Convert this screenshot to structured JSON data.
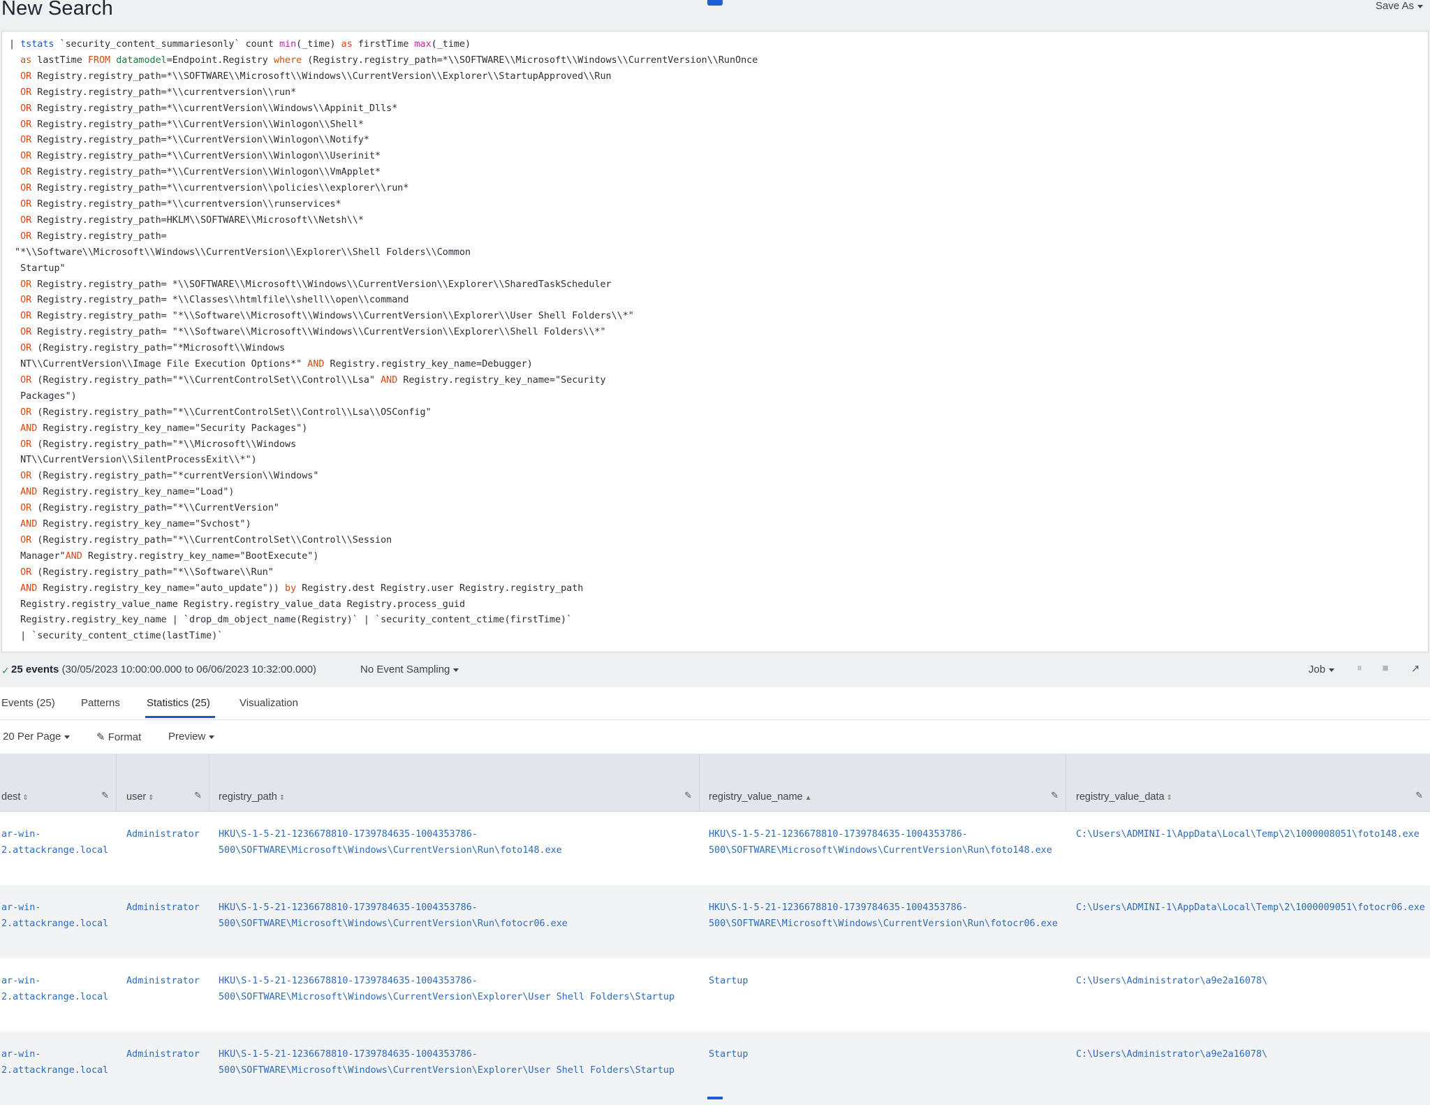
{
  "header": {
    "title": "New Search",
    "save_as_label": "Save As"
  },
  "query_lines": [
    [
      {
        "t": "| ",
        "c": "pipe"
      },
      {
        "t": "tstats",
        "c": "cmd"
      },
      {
        "t": " `security_content_summariesonly` count ",
        "c": "txt"
      },
      {
        "t": "min",
        "c": "fn"
      },
      {
        "t": "(_time) ",
        "c": "txt"
      },
      {
        "t": "as",
        "c": "kw"
      },
      {
        "t": " firstTime ",
        "c": "txt"
      },
      {
        "t": "max",
        "c": "fn"
      },
      {
        "t": "(_time)",
        "c": "txt"
      }
    ],
    [
      {
        "t": "  ",
        "c": "txt"
      },
      {
        "t": "as",
        "c": "kw"
      },
      {
        "t": " lastTime ",
        "c": "txt"
      },
      {
        "t": "FROM",
        "c": "kw"
      },
      {
        "t": " ",
        "c": "txt"
      },
      {
        "t": "datamodel",
        "c": "arg"
      },
      {
        "t": "=Endpoint.Registry ",
        "c": "txt"
      },
      {
        "t": "where",
        "c": "kw"
      },
      {
        "t": " (Registry.registry_path=*\\\\SOFTWARE\\\\Microsoft\\\\Windows\\\\CurrentVersion\\\\RunOnce",
        "c": "txt"
      }
    ],
    [
      {
        "t": "  ",
        "c": "txt"
      },
      {
        "t": "OR",
        "c": "kw"
      },
      {
        "t": " Registry.registry_path=*\\\\SOFTWARE\\\\Microsoft\\\\Windows\\\\CurrentVersion\\\\Explorer\\\\StartupApproved\\\\Run",
        "c": "txt"
      }
    ],
    [
      {
        "t": "  ",
        "c": "txt"
      },
      {
        "t": "OR",
        "c": "kw"
      },
      {
        "t": " Registry.registry_path=*\\\\currentversion\\\\run*",
        "c": "txt"
      }
    ],
    [
      {
        "t": "  ",
        "c": "txt"
      },
      {
        "t": "OR",
        "c": "kw"
      },
      {
        "t": " Registry.registry_path=*\\\\currentVersion\\\\Windows\\\\Appinit_Dlls*",
        "c": "txt"
      }
    ],
    [
      {
        "t": "  ",
        "c": "txt"
      },
      {
        "t": "OR",
        "c": "kw"
      },
      {
        "t": " Registry.registry_path=*\\\\CurrentVersion\\\\Winlogon\\\\Shell*",
        "c": "txt"
      }
    ],
    [
      {
        "t": "  ",
        "c": "txt"
      },
      {
        "t": "OR",
        "c": "kw"
      },
      {
        "t": " Registry.registry_path=*\\\\CurrentVersion\\\\Winlogon\\\\Notify*",
        "c": "txt"
      }
    ],
    [
      {
        "t": "  ",
        "c": "txt"
      },
      {
        "t": "OR",
        "c": "kw"
      },
      {
        "t": " Registry.registry_path=*\\\\CurrentVersion\\\\Winlogon\\\\Userinit*",
        "c": "txt"
      }
    ],
    [
      {
        "t": "  ",
        "c": "txt"
      },
      {
        "t": "OR",
        "c": "kw"
      },
      {
        "t": " Registry.registry_path=*\\\\CurrentVersion\\\\Winlogon\\\\VmApplet*",
        "c": "txt"
      }
    ],
    [
      {
        "t": "  ",
        "c": "txt"
      },
      {
        "t": "OR",
        "c": "kw"
      },
      {
        "t": " Registry.registry_path=*\\\\currentversion\\\\policies\\\\explorer\\\\run*",
        "c": "txt"
      }
    ],
    [
      {
        "t": "  ",
        "c": "txt"
      },
      {
        "t": "OR",
        "c": "kw"
      },
      {
        "t": " Registry.registry_path=*\\\\currentversion\\\\runservices*",
        "c": "txt"
      }
    ],
    [
      {
        "t": "  ",
        "c": "txt"
      },
      {
        "t": "OR",
        "c": "kw"
      },
      {
        "t": " Registry.registry_path=HKLM\\\\SOFTWARE\\\\Microsoft\\\\Netsh\\\\*",
        "c": "txt"
      }
    ],
    [
      {
        "t": "  ",
        "c": "txt"
      },
      {
        "t": "OR",
        "c": "kw"
      },
      {
        "t": " Registry.registry_path=",
        "c": "txt"
      }
    ],
    [
      {
        "t": " \"*\\\\Software\\\\Microsoft\\\\Windows\\\\CurrentVersion\\\\Explorer\\\\Shell Folders\\\\Common",
        "c": "txt"
      }
    ],
    [
      {
        "t": "  Startup\"",
        "c": "txt"
      }
    ],
    [
      {
        "t": "  ",
        "c": "txt"
      },
      {
        "t": "OR",
        "c": "kw"
      },
      {
        "t": " Registry.registry_path= *\\\\SOFTWARE\\\\Microsoft\\\\Windows\\\\CurrentVersion\\\\Explorer\\\\SharedTaskScheduler",
        "c": "txt"
      }
    ],
    [
      {
        "t": "  ",
        "c": "txt"
      },
      {
        "t": "OR",
        "c": "kw"
      },
      {
        "t": " Registry.registry_path= *\\\\Classes\\\\htmlfile\\\\shell\\\\open\\\\command",
        "c": "txt"
      }
    ],
    [
      {
        "t": "  ",
        "c": "txt"
      },
      {
        "t": "OR",
        "c": "kw"
      },
      {
        "t": " Registry.registry_path= \"*\\\\Software\\\\Microsoft\\\\Windows\\\\CurrentVersion\\\\Explorer\\\\User Shell Folders\\\\*\"",
        "c": "txt"
      }
    ],
    [
      {
        "t": "  ",
        "c": "txt"
      },
      {
        "t": "OR",
        "c": "kw"
      },
      {
        "t": " Registry.registry_path= \"*\\\\Software\\\\Microsoft\\\\Windows\\\\CurrentVersion\\\\Explorer\\\\Shell Folders\\\\*\"",
        "c": "txt"
      }
    ],
    [
      {
        "t": "  ",
        "c": "txt"
      },
      {
        "t": "OR",
        "c": "kw"
      },
      {
        "t": " (Registry.registry_path=\"*Microsoft\\\\Windows",
        "c": "txt"
      }
    ],
    [
      {
        "t": "  NT\\\\CurrentVersion\\\\Image File Execution Options*\" ",
        "c": "txt"
      },
      {
        "t": "AND",
        "c": "kw"
      },
      {
        "t": " Registry.registry_key_name=Debugger)",
        "c": "txt"
      }
    ],
    [
      {
        "t": "  ",
        "c": "txt"
      },
      {
        "t": "OR",
        "c": "kw"
      },
      {
        "t": " (Registry.registry_path=\"*\\\\CurrentControlSet\\\\Control\\\\Lsa\" ",
        "c": "txt"
      },
      {
        "t": "AND",
        "c": "kw"
      },
      {
        "t": " Registry.registry_key_name=\"Security",
        "c": "txt"
      }
    ],
    [
      {
        "t": "  Packages\")",
        "c": "txt"
      }
    ],
    [
      {
        "t": "  ",
        "c": "txt"
      },
      {
        "t": "OR",
        "c": "kw"
      },
      {
        "t": " (Registry.registry_path=\"*\\\\CurrentControlSet\\\\Control\\\\Lsa\\\\OSConfig\"",
        "c": "txt"
      }
    ],
    [
      {
        "t": "  ",
        "c": "txt"
      },
      {
        "t": "AND",
        "c": "kw"
      },
      {
        "t": " Registry.registry_key_name=\"Security Packages\")",
        "c": "txt"
      }
    ],
    [
      {
        "t": "  ",
        "c": "txt"
      },
      {
        "t": "OR",
        "c": "kw"
      },
      {
        "t": " (Registry.registry_path=\"*\\\\Microsoft\\\\Windows",
        "c": "txt"
      }
    ],
    [
      {
        "t": "  NT\\\\CurrentVersion\\\\SilentProcessExit\\\\*\")",
        "c": "txt"
      }
    ],
    [
      {
        "t": "  ",
        "c": "txt"
      },
      {
        "t": "OR",
        "c": "kw"
      },
      {
        "t": " (Registry.registry_path=\"*currentVersion\\\\Windows\"",
        "c": "txt"
      }
    ],
    [
      {
        "t": "  ",
        "c": "txt"
      },
      {
        "t": "AND",
        "c": "kw"
      },
      {
        "t": " Registry.registry_key_name=\"Load\")",
        "c": "txt"
      }
    ],
    [
      {
        "t": "  ",
        "c": "txt"
      },
      {
        "t": "OR",
        "c": "kw"
      },
      {
        "t": " (Registry.registry_path=\"*\\\\CurrentVersion\"",
        "c": "txt"
      }
    ],
    [
      {
        "t": "  ",
        "c": "txt"
      },
      {
        "t": "AND",
        "c": "kw"
      },
      {
        "t": " Registry.registry_key_name=\"Svchost\")",
        "c": "txt"
      }
    ],
    [
      {
        "t": "  ",
        "c": "txt"
      },
      {
        "t": "OR",
        "c": "kw"
      },
      {
        "t": " (Registry.registry_path=\"*\\\\CurrentControlSet\\\\Control\\\\Session",
        "c": "txt"
      }
    ],
    [
      {
        "t": "  Manager\"",
        "c": "txt"
      },
      {
        "t": "AND",
        "c": "kw"
      },
      {
        "t": " Registry.registry_key_name=\"BootExecute\")",
        "c": "txt"
      }
    ],
    [
      {
        "t": "  ",
        "c": "txt"
      },
      {
        "t": "OR",
        "c": "kw"
      },
      {
        "t": " (Registry.registry_path=\"*\\\\Software\\\\Run\"",
        "c": "txt"
      }
    ],
    [
      {
        "t": "  ",
        "c": "txt"
      },
      {
        "t": "AND",
        "c": "kw"
      },
      {
        "t": " Registry.registry_key_name=\"auto_update\")) ",
        "c": "txt"
      },
      {
        "t": "by",
        "c": "kw"
      },
      {
        "t": " Registry.dest Registry.user Registry.registry_path",
        "c": "txt"
      }
    ],
    [
      {
        "t": "  Registry.registry_value_name Registry.registry_value_data Registry.process_guid",
        "c": "txt"
      }
    ],
    [
      {
        "t": "  Registry.registry_key_name | `drop_dm_object_name(Registry)` | `security_content_ctime(firstTime)`",
        "c": "txt"
      }
    ],
    [
      {
        "t": "  | `security_content_ctime(lastTime)`",
        "c": "txt"
      }
    ]
  ],
  "status": {
    "check": "✓",
    "event_count": "25 events",
    "time_range": "(30/05/2023 10:00:00.000 to 06/06/2023 10:32:00.000)",
    "sampling": "No Event Sampling",
    "job": "Job",
    "pause_icon": "⏸",
    "stop_icon": "■",
    "share_icon": "↗"
  },
  "tabs": [
    "Events (25)",
    "Patterns",
    "Statistics (25)",
    "Visualization"
  ],
  "toolbar": {
    "per_page": "20 Per Page",
    "format": "Format",
    "preview": "Preview"
  },
  "table": {
    "columns": [
      {
        "name": "dest",
        "sort": "⇕"
      },
      {
        "name": "user",
        "sort": "⇕"
      },
      {
        "name": "registry_path",
        "sort": "⇕"
      },
      {
        "name": "registry_value_name",
        "sort": "▲"
      },
      {
        "name": "registry_value_data",
        "sort": "⇕"
      }
    ],
    "rows": [
      {
        "dest": "ar-win-\n2.attackrange.local",
        "user": "Administrator",
        "registry_path": "HKU\\S-1-5-21-1236678810-1739784635-1004353786-\n500\\SOFTWARE\\Microsoft\\Windows\\CurrentVersion\\Run\\foto148.exe",
        "registry_value_name": "HKU\\S-1-5-21-1236678810-1739784635-1004353786-\n500\\SOFTWARE\\Microsoft\\Windows\\CurrentVersion\\Run\\foto148.exe",
        "registry_value_data": "C:\\Users\\ADMINI-1\\AppData\\Local\\Temp\\2\\1000008051\\foto148.exe"
      },
      {
        "dest": "ar-win-\n2.attackrange.local",
        "user": "Administrator",
        "registry_path": "HKU\\S-1-5-21-1236678810-1739784635-1004353786-\n500\\SOFTWARE\\Microsoft\\Windows\\CurrentVersion\\Run\\fotocr06.exe",
        "registry_value_name": "HKU\\S-1-5-21-1236678810-1739784635-1004353786-\n500\\SOFTWARE\\Microsoft\\Windows\\CurrentVersion\\Run\\fotocr06.exe",
        "registry_value_data": "C:\\Users\\ADMINI-1\\AppData\\Local\\Temp\\2\\1000009051\\fotocr06.exe"
      },
      {
        "dest": "ar-win-\n2.attackrange.local",
        "user": "Administrator",
        "registry_path": "HKU\\S-1-5-21-1236678810-1739784635-1004353786-\n500\\SOFTWARE\\Microsoft\\Windows\\CurrentVersion\\Explorer\\User Shell Folders\\Startup",
        "registry_value_name": "Startup",
        "registry_value_data": "C:\\Users\\Administrator\\a9e2a16078\\"
      },
      {
        "dest": "ar-win-\n2.attackrange.local",
        "user": "Administrator",
        "registry_path": "HKU\\S-1-5-21-1236678810-1739784635-1004353786-\n500\\SOFTWARE\\Microsoft\\Windows\\CurrentVersion\\Explorer\\User Shell Folders\\Startup",
        "registry_value_name": "Startup",
        "registry_value_data": "C:\\Users\\Administrator\\a9e2a16078\\"
      }
    ]
  }
}
